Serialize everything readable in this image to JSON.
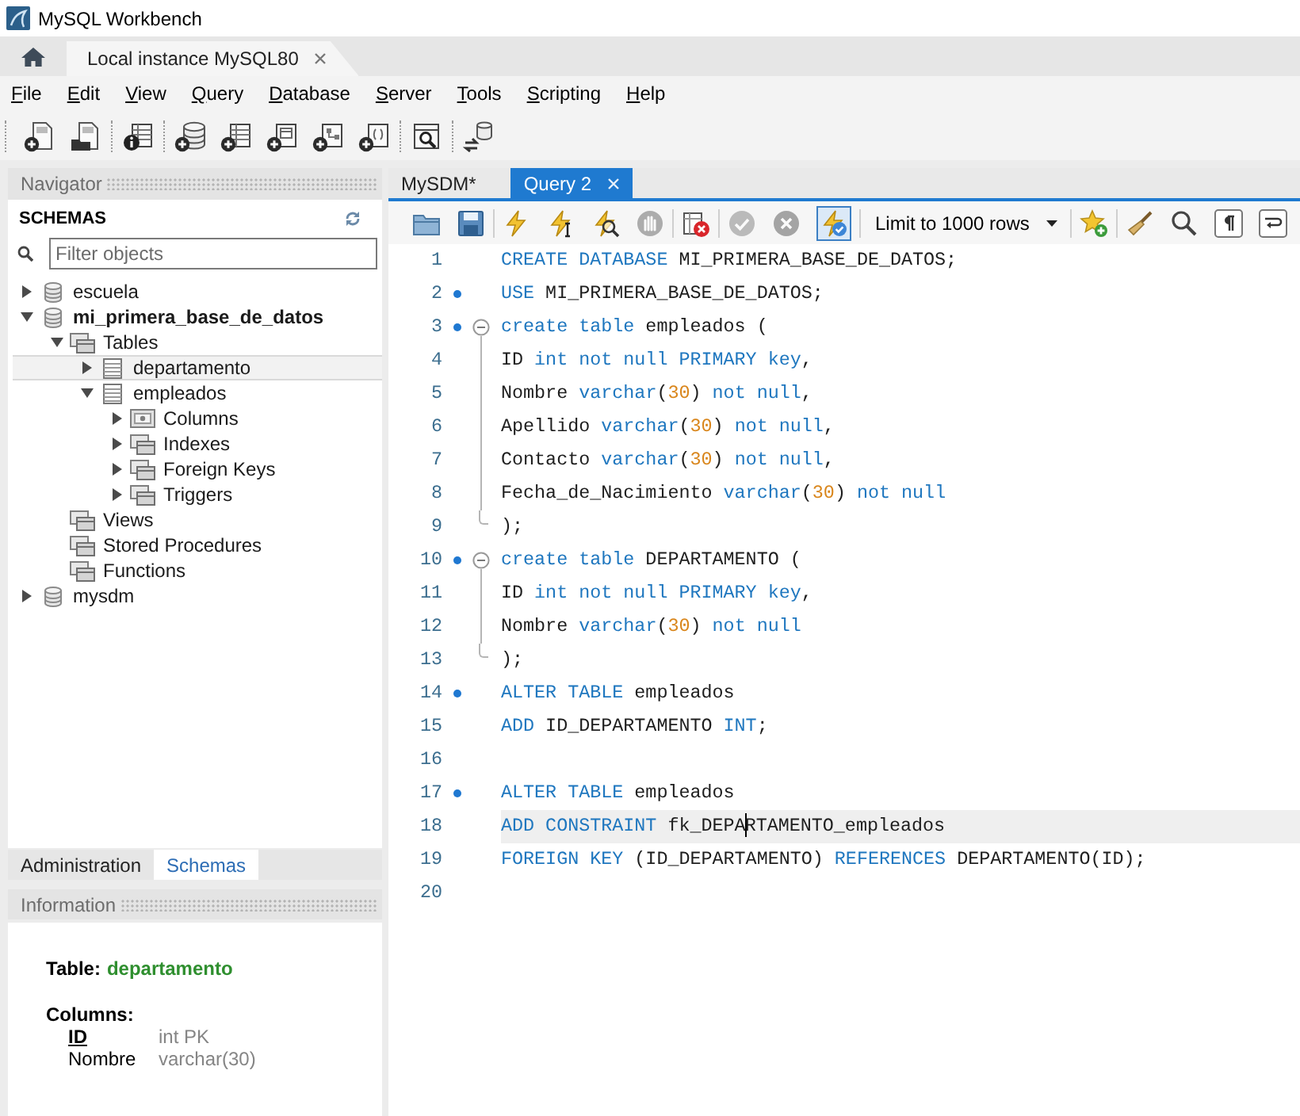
{
  "window": {
    "title": "MySQL Workbench"
  },
  "connection_tabs": [
    {
      "label": "Local instance MySQL80",
      "selected": true
    }
  ],
  "menu": [
    "File",
    "Edit",
    "View",
    "Query",
    "Database",
    "Server",
    "Tools",
    "Scripting",
    "Help"
  ],
  "main_toolbar": {
    "groups": [
      [
        {
          "kind": "new-sql"
        },
        {
          "kind": "open-sql"
        }
      ],
      [
        {
          "kind": "inspector"
        }
      ],
      [
        {
          "kind": "new-schema"
        },
        {
          "kind": "new-table"
        },
        {
          "kind": "new-view"
        },
        {
          "kind": "new-procedure"
        },
        {
          "kind": "new-function"
        }
      ],
      [
        {
          "kind": "search-data"
        }
      ],
      [
        {
          "kind": "reconnect"
        }
      ]
    ]
  },
  "navigator": {
    "title": "Navigator",
    "schemas_label": "SCHEMAS",
    "filter": {
      "placeholder": "Filter objects"
    },
    "tree": [
      {
        "label": "escuela",
        "kind": "schema",
        "default": false,
        "expanded": false,
        "selected": false
      },
      {
        "label": "mi_primera_base_de_datos",
        "kind": "schema",
        "default": true,
        "expanded": true,
        "selected": false,
        "children": [
          {
            "label": "Tables",
            "kind": "group",
            "expanded": true,
            "selected": false,
            "children": [
              {
                "label": "departamento",
                "kind": "table",
                "expanded": false,
                "selected": true
              },
              {
                "label": "empleados",
                "kind": "table",
                "expanded": true,
                "selected": false,
                "children": [
                  {
                    "label": "Columns",
                    "kind": "columns",
                    "expanded": false,
                    "selected": false
                  },
                  {
                    "label": "Indexes",
                    "kind": "group",
                    "expanded": false,
                    "selected": false
                  },
                  {
                    "label": "Foreign Keys",
                    "kind": "group",
                    "expanded": false,
                    "selected": false
                  },
                  {
                    "label": "Triggers",
                    "kind": "group",
                    "expanded": false,
                    "selected": false
                  }
                ]
              }
            ]
          },
          {
            "label": "Views",
            "kind": "group",
            "selected": false
          },
          {
            "label": "Stored Procedures",
            "kind": "group",
            "selected": false
          },
          {
            "label": "Functions",
            "kind": "group",
            "selected": false
          }
        ]
      },
      {
        "label": "mysdm",
        "kind": "schema",
        "default": false,
        "expanded": false,
        "selected": false
      }
    ]
  },
  "sidebar_tabs": [
    {
      "label": "Administration",
      "selected": false
    },
    {
      "label": "Schemas",
      "selected": true
    }
  ],
  "information": {
    "title": "Information",
    "table_label": "Table:",
    "table_name": "departamento",
    "columns_label": "Columns:",
    "columns": [
      {
        "name": "ID",
        "type": "int PK",
        "primary_key": true
      },
      {
        "name": "Nombre",
        "type": "varchar(30)",
        "primary_key": false
      }
    ]
  },
  "editor_tabs": [
    {
      "label": "MySDM*",
      "selected": false,
      "closable": false
    },
    {
      "label": "Query 2",
      "selected": true,
      "closable": true
    }
  ],
  "editor_toolbar": {
    "groups": [
      [
        {
          "kind": "open",
          "disabled": false,
          "on": false
        },
        {
          "kind": "save",
          "disabled": false,
          "on": false
        }
      ],
      [
        {
          "kind": "execute",
          "disabled": false,
          "on": false
        },
        {
          "kind": "execute-current",
          "disabled": false,
          "on": false
        },
        {
          "kind": "explain",
          "disabled": false,
          "on": false
        },
        {
          "kind": "stop",
          "disabled": true,
          "on": false
        }
      ],
      [
        {
          "kind": "error-toggle",
          "disabled": false,
          "on": false
        }
      ],
      [
        {
          "kind": "commit",
          "disabled": true,
          "on": false
        },
        {
          "kind": "rollback",
          "disabled": true,
          "on": false
        },
        {
          "kind": "autocommit",
          "disabled": false,
          "on": true
        }
      ],
      [
        {
          "kind": "limit",
          "value": "Limit to 1000 rows"
        }
      ],
      [
        {
          "kind": "snippet",
          "disabled": false,
          "on": false
        }
      ],
      [
        {
          "kind": "beautify",
          "disabled": false,
          "on": false
        },
        {
          "kind": "find",
          "disabled": false,
          "on": false
        },
        {
          "kind": "invisibles",
          "disabled": false,
          "on": false
        },
        {
          "kind": "wrap",
          "disabled": false,
          "on": false
        }
      ]
    ]
  },
  "editor": {
    "lines": [
      {
        "number": "1",
        "statement": false,
        "current": false,
        "tokens": [
          {
            "kind": "keyword",
            "text": "CREATE DATABASE"
          },
          {
            "kind": "text",
            "text": " MI_PRIMERA_BASE_DE_DATOS;"
          }
        ]
      },
      {
        "number": "2",
        "statement": true,
        "current": false,
        "tokens": [
          {
            "kind": "keyword",
            "text": "USE"
          },
          {
            "kind": "text",
            "text": " MI_PRIMERA_BASE_DE_DATOS;"
          }
        ]
      },
      {
        "number": "3",
        "statement": true,
        "current": false,
        "expanded": true,
        "tokens": [
          {
            "kind": "keyword",
            "text": "create table"
          },
          {
            "kind": "text",
            "text": " empleados ("
          }
        ],
        "children": [
          {
            "number": "4",
            "statement": false,
            "current": false,
            "tokens": [
              {
                "kind": "text",
                "text": "ID "
              },
              {
                "kind": "keyword",
                "text": "int not null PRIMARY key"
              },
              {
                "kind": "text",
                "text": ","
              }
            ]
          },
          {
            "number": "5",
            "statement": false,
            "current": false,
            "tokens": [
              {
                "kind": "text",
                "text": "Nombre "
              },
              {
                "kind": "keyword",
                "text": "varchar"
              },
              {
                "kind": "text",
                "text": "("
              },
              {
                "kind": "number",
                "text": "30"
              },
              {
                "kind": "text",
                "text": ") "
              },
              {
                "kind": "keyword",
                "text": "not null"
              },
              {
                "kind": "text",
                "text": ","
              }
            ]
          },
          {
            "number": "6",
            "statement": false,
            "current": false,
            "tokens": [
              {
                "kind": "text",
                "text": "Apellido "
              },
              {
                "kind": "keyword",
                "text": "varchar"
              },
              {
                "kind": "text",
                "text": "("
              },
              {
                "kind": "number",
                "text": "30"
              },
              {
                "kind": "text",
                "text": ") "
              },
              {
                "kind": "keyword",
                "text": "not null"
              },
              {
                "kind": "text",
                "text": ","
              }
            ]
          },
          {
            "number": "7",
            "statement": false,
            "current": false,
            "tokens": [
              {
                "kind": "text",
                "text": "Contacto "
              },
              {
                "kind": "keyword",
                "text": "varchar"
              },
              {
                "kind": "text",
                "text": "("
              },
              {
                "kind": "number",
                "text": "30"
              },
              {
                "kind": "text",
                "text": ") "
              },
              {
                "kind": "keyword",
                "text": "not null"
              },
              {
                "kind": "text",
                "text": ","
              }
            ]
          },
          {
            "number": "8",
            "statement": false,
            "current": false,
            "tokens": [
              {
                "kind": "text",
                "text": "Fecha_de_Nacimiento "
              },
              {
                "kind": "keyword",
                "text": "varchar"
              },
              {
                "kind": "text",
                "text": "("
              },
              {
                "kind": "number",
                "text": "30"
              },
              {
                "kind": "text",
                "text": ") "
              },
              {
                "kind": "keyword",
                "text": "not null"
              }
            ]
          },
          {
            "number": "9",
            "statement": false,
            "current": false,
            "tokens": [
              {
                "kind": "text",
                "text": ");"
              }
            ]
          }
        ]
      },
      {
        "number": "10",
        "statement": true,
        "current": false,
        "expanded": true,
        "tokens": [
          {
            "kind": "keyword",
            "text": "create table"
          },
          {
            "kind": "text",
            "text": " DEPARTAMENTO ("
          }
        ],
        "children": [
          {
            "number": "11",
            "statement": false,
            "current": false,
            "tokens": [
              {
                "kind": "text",
                "text": "ID "
              },
              {
                "kind": "keyword",
                "text": "int not null PRIMARY key"
              },
              {
                "kind": "text",
                "text": ","
              }
            ]
          },
          {
            "number": "12",
            "statement": false,
            "current": false,
            "tokens": [
              {
                "kind": "text",
                "text": "Nombre "
              },
              {
                "kind": "keyword",
                "text": "varchar"
              },
              {
                "kind": "text",
                "text": "("
              },
              {
                "kind": "number",
                "text": "30"
              },
              {
                "kind": "text",
                "text": ") "
              },
              {
                "kind": "keyword",
                "text": "not null"
              }
            ]
          },
          {
            "number": "13",
            "statement": false,
            "current": false,
            "tokens": [
              {
                "kind": "text",
                "text": ");"
              }
            ]
          }
        ]
      },
      {
        "number": "14",
        "statement": true,
        "current": false,
        "tokens": [
          {
            "kind": "keyword",
            "text": "ALTER TABLE"
          },
          {
            "kind": "text",
            "text": " empleados"
          }
        ]
      },
      {
        "number": "15",
        "statement": false,
        "current": false,
        "tokens": [
          {
            "kind": "keyword",
            "text": "ADD"
          },
          {
            "kind": "text",
            "text": " ID_DEPARTAMENTO "
          },
          {
            "kind": "keyword",
            "text": "INT"
          },
          {
            "kind": "text",
            "text": ";"
          }
        ]
      },
      {
        "number": "16",
        "statement": false,
        "current": false
      },
      {
        "number": "17",
        "statement": true,
        "current": false,
        "tokens": [
          {
            "kind": "keyword",
            "text": "ALTER TABLE"
          },
          {
            "kind": "text",
            "text": " empleados"
          }
        ]
      },
      {
        "number": "18",
        "statement": false,
        "current": true,
        "tokens": [
          {
            "kind": "keyword",
            "text": "ADD CONSTRAINT"
          },
          {
            "kind": "text",
            "text": " fk_DEPA"
          },
          {
            "kind": "caret"
          },
          {
            "kind": "text",
            "text": "RTAMENTO_empleados"
          }
        ]
      },
      {
        "number": "19",
        "statement": false,
        "current": false,
        "tokens": [
          {
            "kind": "keyword",
            "text": "FOREIGN KEY"
          },
          {
            "kind": "text",
            "text": " (ID_DEPARTAMENTO) "
          },
          {
            "kind": "keyword",
            "text": "REFERENCES"
          },
          {
            "kind": "text",
            "text": " DEPARTAMENTO(ID);"
          }
        ]
      },
      {
        "number": "20",
        "statement": false,
        "current": false
      }
    ]
  }
}
